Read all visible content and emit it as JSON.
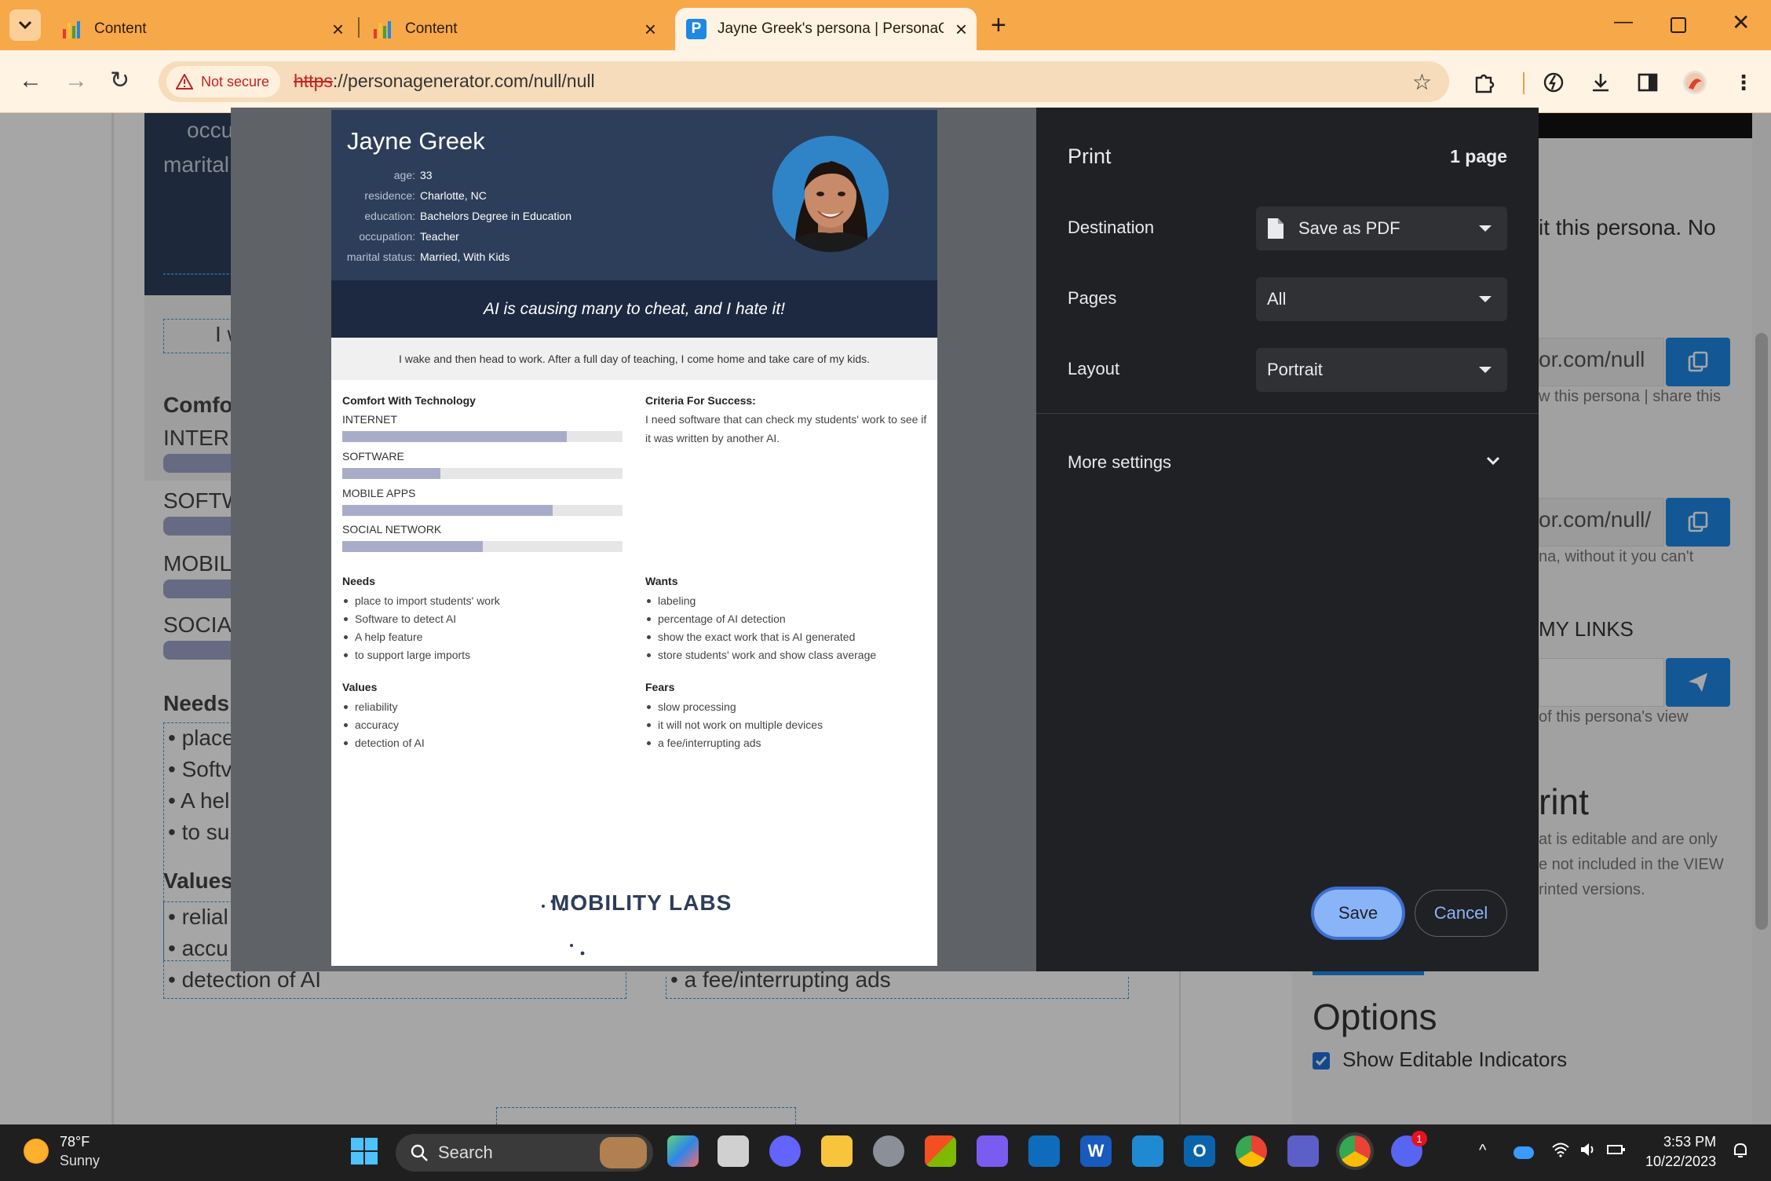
{
  "browser": {
    "tabs": [
      {
        "title": "Content"
      },
      {
        "title": "Content"
      },
      {
        "title": "Jayne Greek's persona | PersonaG"
      }
    ],
    "security_label": "Not secure",
    "url_scheme": "https",
    "url_rest": "://personagenerator.com/null/null"
  },
  "background_page": {
    "left_fragments": [
      "occu",
      "marital",
      "I w",
      "Comfo",
      "INTERN",
      "SOFTW",
      "MOBIL",
      "SOCIAL",
      "Needs",
      "place",
      "Softv",
      "A hel",
      "to su",
      "Values",
      "relial",
      "accu",
      "detection of AI"
    ],
    "fears_fragment": "a fee/interrupting ads",
    "right_fragments": {
      "edit_text": "it this persona. No",
      "link1": "or.com/null",
      "link1_help": "w this persona | share this",
      "link2": "or.com/null/",
      "link2_help": "na, without it you can't",
      "mylinks": "MY LINKS",
      "share_help": "of this persona's view",
      "print_heading": "rint",
      "print_line1": "at is editable and are only",
      "print_line2": "e not included in the VIEW",
      "print_line3": "rinted versions."
    },
    "options_heading": "Options",
    "show_editable_label": "Show Editable Indicators"
  },
  "persona": {
    "name": "Jayne Greek",
    "attributes": [
      {
        "key": "age:",
        "value": "33"
      },
      {
        "key": "residence:",
        "value": "Charlotte, NC"
      },
      {
        "key": "education:",
        "value": "Bachelors Degree in Education"
      },
      {
        "key": "occupation:",
        "value": "Teacher"
      },
      {
        "key": "marital status:",
        "value": "Married, With Kids"
      }
    ],
    "quote": "AI is causing many to cheat, and I hate it!",
    "day": "I wake and then head to work. After a full day of teaching, I come home and take care of my kids.",
    "comfort_title": "Comfort With Technology",
    "comfort": [
      {
        "label": "INTERNET",
        "level": 0.8
      },
      {
        "label": "SOFTWARE",
        "level": 0.35
      },
      {
        "label": "MOBILE APPS",
        "level": 0.75
      },
      {
        "label": "SOCIAL NETWORK",
        "level": 0.5
      }
    ],
    "criteria_title": "Criteria For Success:",
    "criteria_text": "I need software that can check my students' work to see if it was written by another AI.",
    "needs_title": "Needs",
    "needs": [
      "place to import students' work",
      "Software to detect AI",
      "A help feature",
      "to support large imports"
    ],
    "wants_title": "Wants",
    "wants": [
      "labeling",
      "percentage of AI detection",
      "show the exact work that is AI generated",
      "store students' work and show class average"
    ],
    "values_title": "Values",
    "values": [
      "reliability",
      "accuracy",
      "detection of AI"
    ],
    "fears_title": "Fears",
    "fears": [
      "slow processing",
      "it will not work on multiple devices",
      "a fee/interrupting ads"
    ],
    "logo": "MOBILITY LABS"
  },
  "print_dialog": {
    "title": "Print",
    "page_count": "1 page",
    "destination_label": "Destination",
    "destination_value": "Save as PDF",
    "pages_label": "Pages",
    "pages_value": "All",
    "layout_label": "Layout",
    "layout_value": "Portrait",
    "more_settings": "More settings",
    "save": "Save",
    "cancel": "Cancel"
  },
  "taskbar": {
    "temperature": "78°F",
    "weather": "Sunny",
    "search_placeholder": "Search",
    "time": "3:53 PM",
    "date": "10/22/2023",
    "discord_badge": "1"
  },
  "colors": {
    "tab_bar": "#f7a849",
    "toolbar": "#fff3e4",
    "persona_header": "#2d3e5a",
    "quote_bar": "#1d2941",
    "dialog_bg": "#202124",
    "save_button": "#8ab4f8",
    "accent_blue": "#1e88e5"
  }
}
